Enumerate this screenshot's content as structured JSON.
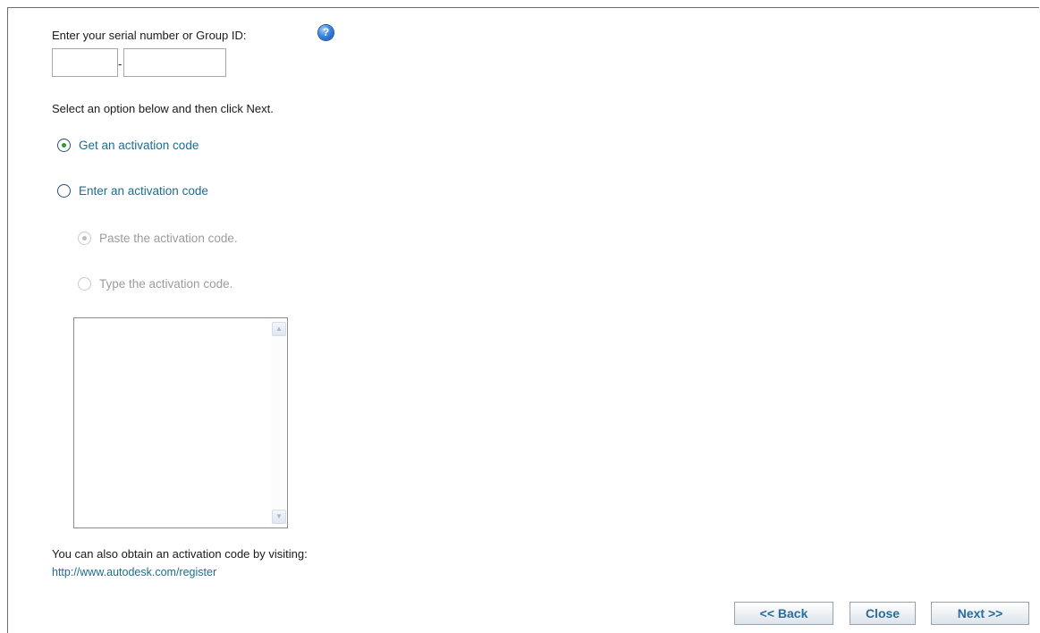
{
  "serial": {
    "label": "Enter your serial number or Group ID:",
    "help_icon": "help-icon",
    "part1_value": "",
    "part2_value": "",
    "separator": "-"
  },
  "instruction": "Select an option below and then click Next.",
  "options": {
    "get_code": {
      "label": "Get an activation code",
      "checked": true
    },
    "enter_code": {
      "label": "Enter an activation code",
      "checked": false
    },
    "paste_code": {
      "label": "Paste the activation code.",
      "checked": true,
      "disabled": true
    },
    "type_code": {
      "label": "Type the activation code.",
      "checked": false,
      "disabled": true
    }
  },
  "code_area": {
    "value": ""
  },
  "footer": {
    "text": "You can also obtain an activation code by visiting:",
    "link": "http://www.autodesk.com/register"
  },
  "buttons": {
    "back": "<< Back",
    "close": "Close",
    "next": "Next >>"
  }
}
